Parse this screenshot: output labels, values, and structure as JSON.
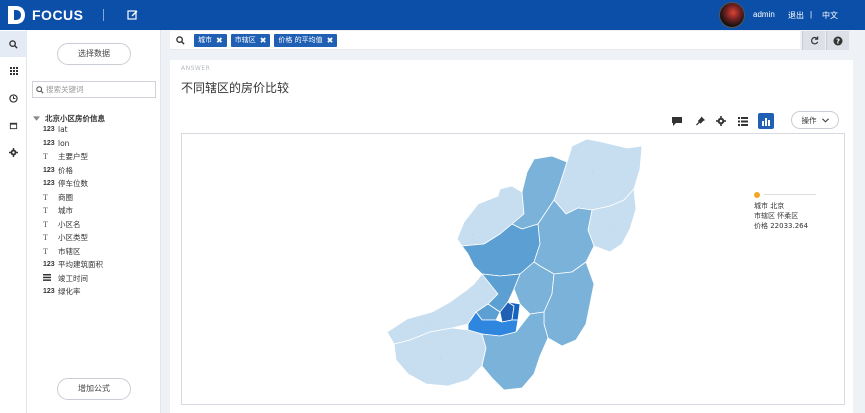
{
  "app": {
    "brand": "FOCUS",
    "user": "admin",
    "logout": "退出",
    "separator": "|",
    "language": "中文",
    "colors": {
      "topbar": "#0b4fa8",
      "chip": "#1f5fb4"
    }
  },
  "rail": {
    "items": [
      {
        "name": "search-icon",
        "active": true
      },
      {
        "name": "grid-icon",
        "active": false
      },
      {
        "name": "clock-icon",
        "active": false
      },
      {
        "name": "calendar-icon",
        "active": false
      },
      {
        "name": "gear-icon",
        "active": false
      }
    ]
  },
  "leftpanel": {
    "select_data": "选择数据",
    "search_placeholder": "搜索关键词",
    "dataset": "北京小区房价信息",
    "fields": [
      {
        "type": "123",
        "label": "lat"
      },
      {
        "type": "123",
        "label": "lon"
      },
      {
        "type": "T",
        "label": "主要户型"
      },
      {
        "type": "123",
        "label": "价格"
      },
      {
        "type": "123",
        "label": "停车位数"
      },
      {
        "type": "T",
        "label": "商圈"
      },
      {
        "type": "T",
        "label": "城市"
      },
      {
        "type": "T",
        "label": "小区名"
      },
      {
        "type": "T",
        "label": "小区类型"
      },
      {
        "type": "T",
        "label": "市辖区"
      },
      {
        "type": "123",
        "label": "平均建筑面积"
      },
      {
        "type": "date",
        "label": "竣工时间"
      },
      {
        "type": "123",
        "label": "绿化率"
      }
    ],
    "add_formula": "增加公式"
  },
  "query": {
    "chips": [
      {
        "label": "城市"
      },
      {
        "label": "市辖区"
      },
      {
        "label": "价格 的平均值"
      }
    ]
  },
  "answer": {
    "label": "ANSWER",
    "title": "不同辖区的房价比较",
    "ops": "操作",
    "tooltip": {
      "line1": "城市 北京",
      "line2": "市辖区 怀柔区",
      "line3": "价格 22033.264"
    }
  }
}
